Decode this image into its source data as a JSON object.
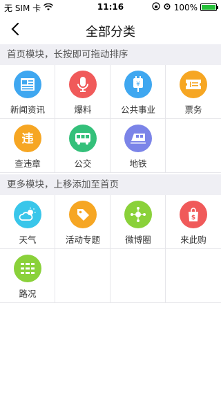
{
  "status": {
    "carrier": "无 SIM 卡",
    "time": "11:16",
    "battery": "100%",
    "battery_level": 1.0
  },
  "nav": {
    "title": "全部分类"
  },
  "section1": {
    "title": "首页模块，长按即可拖动排序",
    "items": [
      {
        "label": "新闻资讯",
        "icon": "news-icon",
        "color": "#3fa7f0"
      },
      {
        "label": "爆料",
        "icon": "microphone-icon",
        "color": "#f05a5a"
      },
      {
        "label": "公共事业",
        "icon": "power-plug-icon",
        "color": "#3fa7f0"
      },
      {
        "label": "票务",
        "icon": "ticket-icon",
        "color": "#f6a623"
      },
      {
        "label": "查违章",
        "icon": "traffic-violation-icon",
        "color": "#f6a623"
      },
      {
        "label": "公交",
        "icon": "bus-icon",
        "color": "#34c07a"
      },
      {
        "label": "地铁",
        "icon": "subway-icon",
        "color": "#7b84e8"
      }
    ]
  },
  "section2": {
    "title": "更多模块，上移添加至首页",
    "items": [
      {
        "label": "天气",
        "icon": "weather-icon",
        "color": "#39c6ea"
      },
      {
        "label": "活动专题",
        "icon": "tag-icon",
        "color": "#f6a623"
      },
      {
        "label": "微博圈",
        "icon": "weibo-circle-icon",
        "color": "#8ad13a"
      },
      {
        "label": "来此购",
        "icon": "shopping-bag-icon",
        "color": "#f05a5a"
      },
      {
        "label": "路况",
        "icon": "road-condition-icon",
        "color": "#8ad13a"
      }
    ]
  }
}
